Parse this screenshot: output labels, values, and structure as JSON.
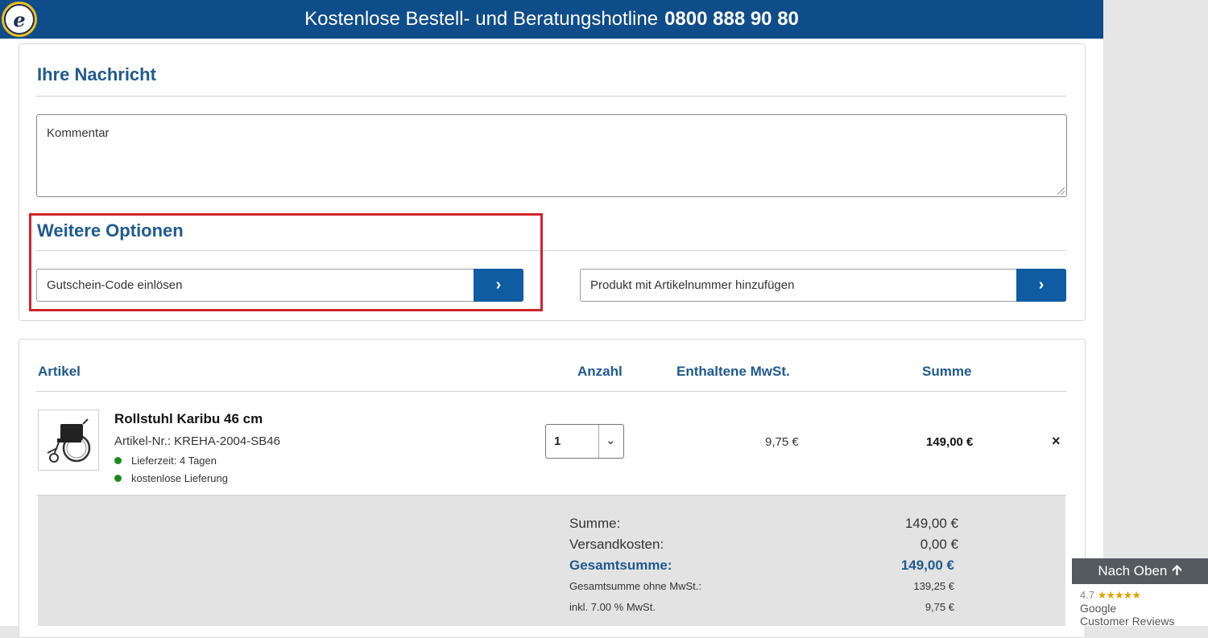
{
  "topbar": {
    "text": "Kostenlose Bestell- und Beratungshotline",
    "phone": "0800 888 90 80",
    "logo_letter": "e"
  },
  "message": {
    "heading": "Ihre Nachricht",
    "comment_placeholder": "Kommentar"
  },
  "options": {
    "heading": "Weitere Optionen",
    "voucher_label": "Gutschein-Code einlösen",
    "article_label": "Produkt mit Artikelnummer hinzufügen",
    "go_icon": "›"
  },
  "cart": {
    "headers": {
      "article": "Artikel",
      "qty": "Anzahl",
      "vat": "Enthaltene MwSt.",
      "sum": "Summe"
    },
    "item": {
      "name": "Rollstuhl Karibu 46 cm",
      "sku": "Artikel-Nr.: KREHA-2004-SB46",
      "delivery_time": "Lieferzeit:  4 Tagen",
      "shipping": "kostenlose Lieferung",
      "qty": "1",
      "qty_chevron": "⌄",
      "vat": "9,75 €",
      "sum": "149,00 €",
      "remove": "×"
    }
  },
  "summary": {
    "sum_label": "Summe:",
    "sum_value": "149,00 €",
    "shipping_label": "Versandkosten:",
    "shipping_value": "0,00 €",
    "total_label": "Gesamtsumme:",
    "total_value": "149,00 €",
    "net_label": "Gesamtsumme ohne MwSt.:",
    "net_value": "139,25 €",
    "vat_label": "inkl. 7.00 % MwSt.",
    "vat_value": "9,75 €"
  },
  "widgets": {
    "scroll_top": "Nach Oben",
    "scroll_top_icon": "🡩",
    "rating": "4.7",
    "stars": "★★★★★",
    "reviews_line1": "Google",
    "reviews_line2": "Customer Reviews"
  }
}
